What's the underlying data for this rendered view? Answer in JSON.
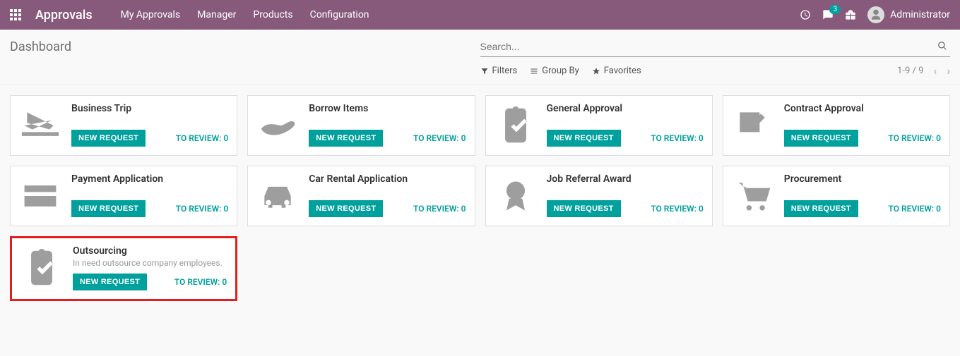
{
  "nav": {
    "brand": "Approvals",
    "links": [
      "My Approvals",
      "Manager",
      "Products",
      "Configuration"
    ],
    "msg_count": "3",
    "user": "Administrator"
  },
  "page": {
    "title": "Dashboard",
    "search_placeholder": "Search...",
    "filters_label": "Filters",
    "groupby_label": "Group By",
    "favorites_label": "Favorites",
    "pager": "1-9 / 9"
  },
  "buttons": {
    "new_request": "NEW REQUEST",
    "review_prefix": "TO REVIEW: "
  },
  "cards": [
    {
      "title": "Business Trip",
      "desc": "",
      "review": 0,
      "icon": "plane",
      "highlight": false
    },
    {
      "title": "Borrow Items",
      "desc": "",
      "review": 0,
      "icon": "hand",
      "highlight": false
    },
    {
      "title": "General Approval",
      "desc": "",
      "review": 0,
      "icon": "clipboard-check",
      "highlight": false
    },
    {
      "title": "Contract Approval",
      "desc": "",
      "review": 0,
      "icon": "sign",
      "highlight": false
    },
    {
      "title": "Payment Application",
      "desc": "",
      "review": 0,
      "icon": "credit-card",
      "highlight": false
    },
    {
      "title": "Car Rental Application",
      "desc": "",
      "review": 0,
      "icon": "car",
      "highlight": false
    },
    {
      "title": "Job Referral Award",
      "desc": "",
      "review": 0,
      "icon": "award",
      "highlight": false
    },
    {
      "title": "Procurement",
      "desc": "",
      "review": 0,
      "icon": "cart",
      "highlight": false
    },
    {
      "title": "Outsourcing",
      "desc": "In need outsource company employees.",
      "review": 0,
      "icon": "clipboard-check",
      "highlight": true
    }
  ]
}
